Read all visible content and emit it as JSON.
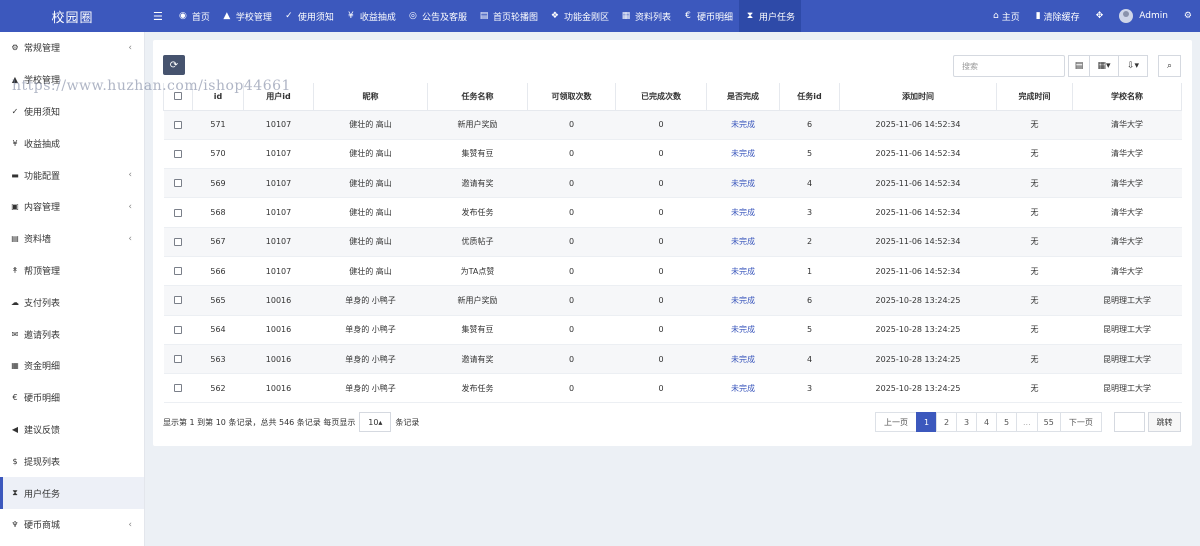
{
  "app": {
    "logo": "校园圈"
  },
  "topnav": [
    {
      "label": "首页",
      "icon": "dashboard-icon",
      "glyph": "◉"
    },
    {
      "label": "学校管理",
      "icon": "graduation-cap-icon",
      "glyph": "▲"
    },
    {
      "label": "使用须知",
      "icon": "thumbs-up-icon",
      "glyph": "✓"
    },
    {
      "label": "收益抽成",
      "icon": "yen-icon",
      "glyph": "¥"
    },
    {
      "label": "公告及客服",
      "icon": "headset-icon",
      "glyph": "◎"
    },
    {
      "label": "首页轮播图",
      "icon": "chart-area-icon",
      "glyph": "▤"
    },
    {
      "label": "功能金刚区",
      "icon": "cubes-icon",
      "glyph": "❖"
    },
    {
      "label": "资料列表",
      "icon": "list-alt-icon",
      "glyph": "▦"
    },
    {
      "label": "硬币明细",
      "icon": "euro-icon",
      "glyph": "€"
    },
    {
      "label": "用户任务",
      "icon": "hourglass-icon",
      "glyph": "⧗"
    }
  ],
  "topright": {
    "home": "主页",
    "clear_cache": "清除缓存",
    "admin": "Admin"
  },
  "sidebar": [
    {
      "label": "常规管理",
      "glyph": "⚙",
      "icon": "cogs-icon",
      "arrow": true
    },
    {
      "label": "学校管理",
      "glyph": "▲",
      "icon": "graduation-cap-icon",
      "arrow": false
    },
    {
      "label": "使用须知",
      "glyph": "✓",
      "icon": "thumbs-up-icon",
      "arrow": false
    },
    {
      "label": "收益抽成",
      "glyph": "¥",
      "icon": "yen-icon",
      "arrow": false
    },
    {
      "label": "功能配置",
      "glyph": "▬",
      "icon": "car-icon",
      "arrow": true
    },
    {
      "label": "内容管理",
      "glyph": "▣",
      "icon": "id-card-icon",
      "arrow": true
    },
    {
      "label": "资料墙",
      "glyph": "▤",
      "icon": "file-text-icon",
      "arrow": true
    },
    {
      "label": "帮顶管理",
      "glyph": "↟",
      "icon": "level-up-icon",
      "arrow": false
    },
    {
      "label": "支付列表",
      "glyph": "☁",
      "icon": "cloud-icon",
      "arrow": false
    },
    {
      "label": "邀请列表",
      "glyph": "✉",
      "icon": "envelope-open-icon",
      "arrow": false
    },
    {
      "label": "资金明细",
      "glyph": "▦",
      "icon": "calculator-icon",
      "arrow": false
    },
    {
      "label": "硬币明细",
      "glyph": "€",
      "icon": "euro-icon",
      "arrow": false
    },
    {
      "label": "建议反馈",
      "glyph": "◀",
      "icon": "volume-icon",
      "arrow": false
    },
    {
      "label": "提现列表",
      "glyph": "$",
      "icon": "dollar-icon",
      "arrow": false
    },
    {
      "label": "用户任务",
      "glyph": "⧗",
      "icon": "hourglass-icon",
      "arrow": false,
      "active": true
    },
    {
      "label": "硬币商城",
      "glyph": "♆",
      "icon": "trident-icon",
      "arrow": true
    }
  ],
  "search": {
    "placeholder": "搜索"
  },
  "table": {
    "columns": [
      "id",
      "用户id",
      "昵称",
      "任务名称",
      "可领取次数",
      "已完成次数",
      "是否完成",
      "任务id",
      "添加时间",
      "完成时间",
      "学校名称"
    ],
    "rows": [
      [
        "571",
        "10107",
        "健壮的 高山",
        "新用户奖励",
        "0",
        "0",
        "未完成",
        "6",
        "2025-11-06 14:52:34",
        "无",
        "清华大学"
      ],
      [
        "570",
        "10107",
        "健壮的 高山",
        "集赞有豆",
        "0",
        "0",
        "未完成",
        "5",
        "2025-11-06 14:52:34",
        "无",
        "清华大学"
      ],
      [
        "569",
        "10107",
        "健壮的 高山",
        "邀请有奖",
        "0",
        "0",
        "未完成",
        "4",
        "2025-11-06 14:52:34",
        "无",
        "清华大学"
      ],
      [
        "568",
        "10107",
        "健壮的 高山",
        "发布任务",
        "0",
        "0",
        "未完成",
        "3",
        "2025-11-06 14:52:34",
        "无",
        "清华大学"
      ],
      [
        "567",
        "10107",
        "健壮的 高山",
        "优质帖子",
        "0",
        "0",
        "未完成",
        "2",
        "2025-11-06 14:52:34",
        "无",
        "清华大学"
      ],
      [
        "566",
        "10107",
        "健壮的 高山",
        "为TA点赞",
        "0",
        "0",
        "未完成",
        "1",
        "2025-11-06 14:52:34",
        "无",
        "清华大学"
      ],
      [
        "565",
        "10016",
        "单身的 小鸭子",
        "新用户奖励",
        "0",
        "0",
        "未完成",
        "6",
        "2025-10-28 13:24:25",
        "无",
        "昆明理工大学"
      ],
      [
        "564",
        "10016",
        "单身的 小鸭子",
        "集赞有豆",
        "0",
        "0",
        "未完成",
        "5",
        "2025-10-28 13:24:25",
        "无",
        "昆明理工大学"
      ],
      [
        "563",
        "10016",
        "单身的 小鸭子",
        "邀请有奖",
        "0",
        "0",
        "未完成",
        "4",
        "2025-10-28 13:24:25",
        "无",
        "昆明理工大学"
      ],
      [
        "562",
        "10016",
        "单身的 小鸭子",
        "发布任务",
        "0",
        "0",
        "未完成",
        "3",
        "2025-10-28 13:24:25",
        "无",
        "昆明理工大学"
      ]
    ]
  },
  "footer": {
    "summary": "显示第 1 到第 10 条记录，总共 546 条记录 每页显示",
    "page_size": "10",
    "suffix": "条记录"
  },
  "pagination": {
    "prev": "上一页",
    "pages": [
      "1",
      "2",
      "3",
      "4",
      "5",
      "...",
      "55"
    ],
    "current": "1",
    "next": "下一页",
    "jump": "跳转"
  },
  "watermark": "https://www.huzhan.com/ishop44661",
  "colors": {
    "primary": "#3c58bd",
    "refresh_btn": "#46536e"
  }
}
